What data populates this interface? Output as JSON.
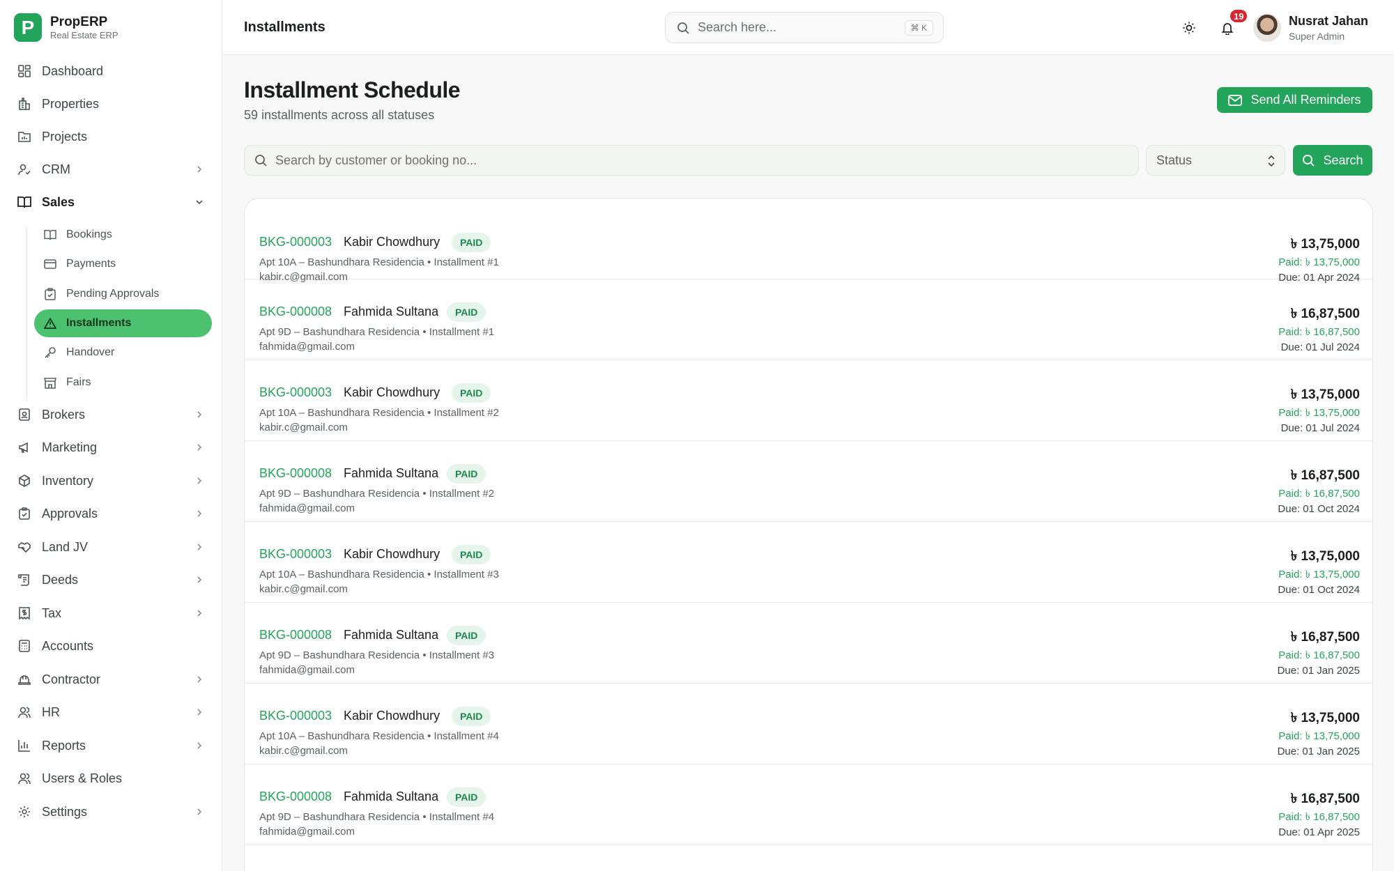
{
  "brand": {
    "logo_letter": "P",
    "name": "PropERP",
    "subtitle": "Real Estate ERP",
    "color": "#22a45a"
  },
  "nav": [
    {
      "label": "Dashboard",
      "icon": "grid-icon",
      "has_chevron": false
    },
    {
      "label": "Properties",
      "icon": "building-icon",
      "has_chevron": false
    },
    {
      "label": "Projects",
      "icon": "folder-chart-icon",
      "has_chevron": false
    },
    {
      "label": "CRM",
      "icon": "user-check-icon",
      "has_chevron": true
    },
    {
      "label": "Sales",
      "icon": "book-open-icon",
      "has_chevron": true,
      "expanded": true
    }
  ],
  "sales_sub": [
    {
      "label": "Bookings",
      "icon": "book-open-icon",
      "active": false
    },
    {
      "label": "Payments",
      "icon": "credit-card-icon",
      "active": false
    },
    {
      "label": "Pending Approvals",
      "icon": "clipboard-check-icon",
      "active": false
    },
    {
      "label": "Installments",
      "icon": "warning-triangle-icon",
      "active": true
    },
    {
      "label": "Handover",
      "icon": "key-icon",
      "active": false
    },
    {
      "label": "Fairs",
      "icon": "store-icon",
      "active": false
    }
  ],
  "nav_bottom": [
    {
      "label": "Brokers",
      "icon": "id-badge-icon",
      "has_chevron": true
    },
    {
      "label": "Marketing",
      "icon": "megaphone-icon",
      "has_chevron": true
    },
    {
      "label": "Inventory",
      "icon": "package-icon",
      "has_chevron": true
    },
    {
      "label": "Approvals",
      "icon": "clipboard-check-icon",
      "has_chevron": true
    },
    {
      "label": "Land JV",
      "icon": "handshake-icon",
      "has_chevron": true
    },
    {
      "label": "Deeds",
      "icon": "scroll-icon",
      "has_chevron": true
    },
    {
      "label": "Tax",
      "icon": "receipt-dollar-icon",
      "has_chevron": true
    },
    {
      "label": "Accounts",
      "icon": "calculator-icon",
      "has_chevron": false
    },
    {
      "label": "Contractor",
      "icon": "hard-hat-icon",
      "has_chevron": true
    },
    {
      "label": "HR",
      "icon": "users-icon",
      "has_chevron": true
    },
    {
      "label": "Reports",
      "icon": "bar-chart-icon",
      "has_chevron": true
    },
    {
      "label": "Users & Roles",
      "icon": "users-icon",
      "has_chevron": false
    },
    {
      "label": "Settings",
      "icon": "gear-icon",
      "has_chevron": true
    }
  ],
  "header": {
    "title": "Installments",
    "search_placeholder": "Search here...",
    "shortcut": "⌘ K",
    "notification_count": "19",
    "user_name": "Nusrat Jahan",
    "user_role": "Super Admin"
  },
  "page": {
    "title": "Installment Schedule",
    "subtitle": "59 installments across all statuses",
    "reminder_button": "Send All Reminders",
    "filter_placeholder": "Search by customer or booking no...",
    "status_select": "Status",
    "search_button": "Search"
  },
  "installments": [
    {
      "booking": "BKG-000003",
      "customer": "Kabir Chowdhury",
      "status": "PAID",
      "unit": "Apt 10A – Bashundhara Residencia • Installment #1",
      "email": "kabir.c@gmail.com",
      "amount": "৳ 13,75,000",
      "paid": "Paid: ৳ 13,75,000",
      "due": "Due: 01 Apr 2024"
    },
    {
      "booking": "BKG-000008",
      "customer": "Fahmida Sultana",
      "status": "PAID",
      "unit": "Apt 9D – Bashundhara Residencia • Installment #1",
      "email": "fahmida@gmail.com",
      "amount": "৳ 16,87,500",
      "paid": "Paid: ৳ 16,87,500",
      "due": "Due: 01 Jul 2024"
    },
    {
      "booking": "BKG-000003",
      "customer": "Kabir Chowdhury",
      "status": "PAID",
      "unit": "Apt 10A – Bashundhara Residencia • Installment #2",
      "email": "kabir.c@gmail.com",
      "amount": "৳ 13,75,000",
      "paid": "Paid: ৳ 13,75,000",
      "due": "Due: 01 Jul 2024"
    },
    {
      "booking": "BKG-000008",
      "customer": "Fahmida Sultana",
      "status": "PAID",
      "unit": "Apt 9D – Bashundhara Residencia • Installment #2",
      "email": "fahmida@gmail.com",
      "amount": "৳ 16,87,500",
      "paid": "Paid: ৳ 16,87,500",
      "due": "Due: 01 Oct 2024"
    },
    {
      "booking": "BKG-000003",
      "customer": "Kabir Chowdhury",
      "status": "PAID",
      "unit": "Apt 10A – Bashundhara Residencia • Installment #3",
      "email": "kabir.c@gmail.com",
      "amount": "৳ 13,75,000",
      "paid": "Paid: ৳ 13,75,000",
      "due": "Due: 01 Oct 2024"
    },
    {
      "booking": "BKG-000008",
      "customer": "Fahmida Sultana",
      "status": "PAID",
      "unit": "Apt 9D – Bashundhara Residencia • Installment #3",
      "email": "fahmida@gmail.com",
      "amount": "৳ 16,87,500",
      "paid": "Paid: ৳ 16,87,500",
      "due": "Due: 01 Jan 2025"
    },
    {
      "booking": "BKG-000003",
      "customer": "Kabir Chowdhury",
      "status": "PAID",
      "unit": "Apt 10A – Bashundhara Residencia • Installment #4",
      "email": "kabir.c@gmail.com",
      "amount": "৳ 13,75,000",
      "paid": "Paid: ৳ 13,75,000",
      "due": "Due: 01 Jan 2025"
    },
    {
      "booking": "BKG-000008",
      "customer": "Fahmida Sultana",
      "status": "PAID",
      "unit": "Apt 9D – Bashundhara Residencia • Installment #4",
      "email": "fahmida@gmail.com",
      "amount": "৳ 16,87,500",
      "paid": "Paid: ৳ 16,87,500",
      "due": "Due: 01 Apr 2025"
    }
  ]
}
